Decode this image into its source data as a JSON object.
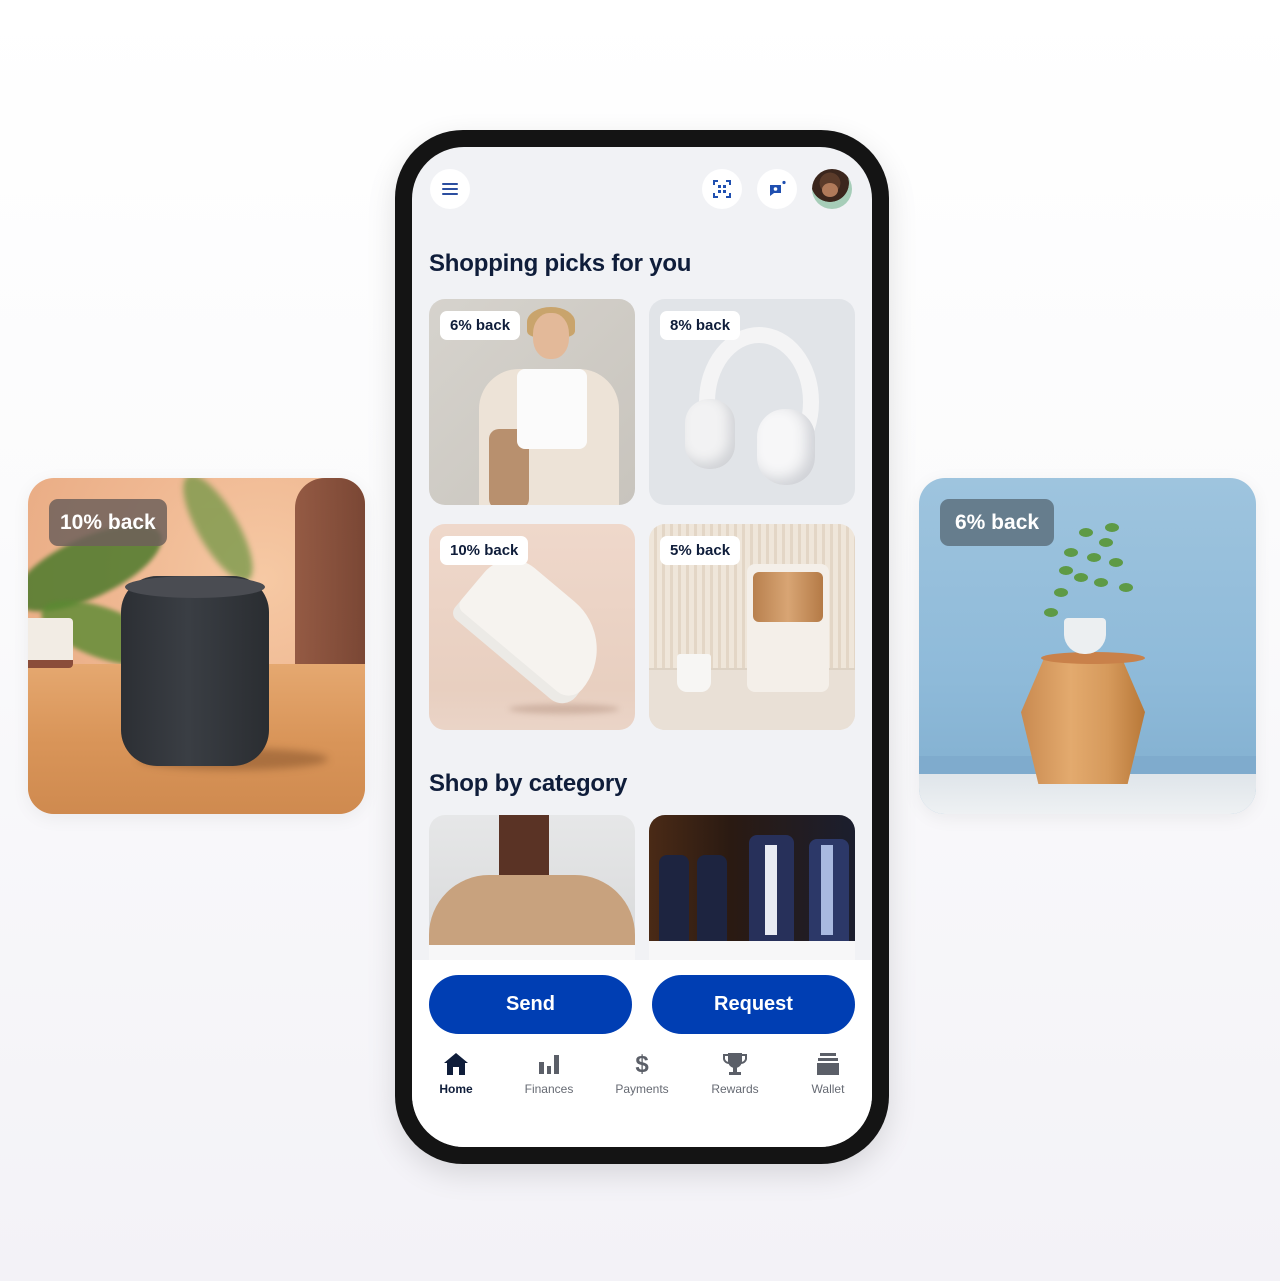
{
  "side_cards": {
    "left": {
      "badge": "10% back",
      "subject": "smart speaker"
    },
    "right": {
      "badge": "6% back",
      "subject": "plant on wooden stool"
    }
  },
  "app": {
    "topbar": {
      "menu_icon": "hamburger-menu",
      "scan_icon": "qr-scan",
      "chat_icon": "chat-bubble",
      "avatar": "user-profile-photo"
    },
    "picks": {
      "title": "Shopping picks for you",
      "items": [
        {
          "badge": "6% back",
          "subject": "woman in white outfit"
        },
        {
          "badge": "8% back",
          "subject": "white headphones"
        },
        {
          "badge": "10% back",
          "subject": "white sneaker"
        },
        {
          "badge": "5% back",
          "subject": "coffee machine"
        }
      ]
    },
    "categories": {
      "title": "Shop by category",
      "items": [
        {
          "subject": "women's blazer fashion"
        },
        {
          "subject": "men's suits"
        }
      ]
    },
    "actions": {
      "send": "Send",
      "request": "Request"
    },
    "nav": {
      "items": [
        {
          "label": "Home",
          "icon": "home",
          "active": true
        },
        {
          "label": "Finances",
          "icon": "bar-chart",
          "active": false
        },
        {
          "label": "Payments",
          "icon": "dollar",
          "active": false
        },
        {
          "label": "Rewards",
          "icon": "trophy",
          "active": false
        },
        {
          "label": "Wallet",
          "icon": "wallet",
          "active": false
        }
      ]
    },
    "colors": {
      "primary": "#003eb3",
      "heading": "#0f1d3a",
      "nav_inactive": "#666a73"
    }
  }
}
